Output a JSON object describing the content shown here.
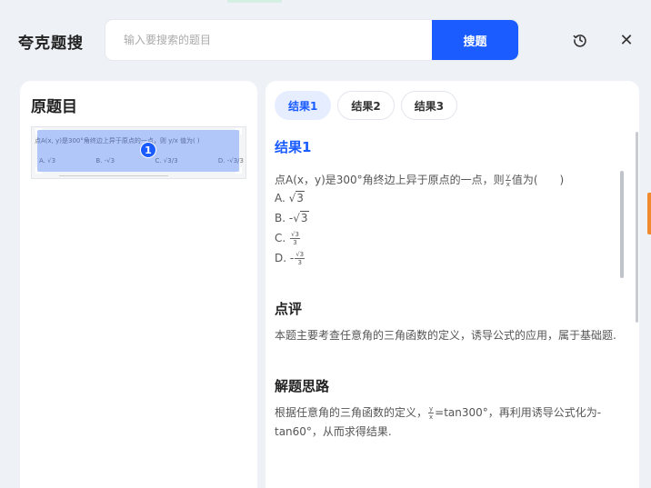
{
  "app": {
    "title": "夸克题搜"
  },
  "search": {
    "placeholder": "输入要搜索的题目",
    "value": "",
    "button_label": "搜题"
  },
  "toolbar": {
    "history_icon": "history-icon",
    "close_icon": "close-icon",
    "close_glyph": "✕"
  },
  "left_panel": {
    "title": "原题目",
    "thumbnail": {
      "question_text": "点A(x, y)是300°角终边上异于原点的一点，则 y/x 值为(   )",
      "options": [
        "A. √3",
        "B. -√3",
        "C. √3/3",
        "D. -√3/3"
      ],
      "badge": "1"
    }
  },
  "tabs": [
    {
      "label": "结果1",
      "active": true
    },
    {
      "label": "结果2",
      "active": false
    },
    {
      "label": "结果3",
      "active": false
    }
  ],
  "result": {
    "heading": "结果1",
    "question_pre": "点A(x，y)是300°角终边上异于原点的一点，则",
    "question_frac_num": "y",
    "question_frac_den": "x",
    "question_post": "值为(　　)",
    "options": {
      "a_label": "A. ",
      "a_value": "3",
      "b_label": "B. -",
      "b_value": "3",
      "c_label": "C. ",
      "c_num": "3",
      "c_den": "3",
      "d_label": "D. -",
      "d_num": "3",
      "d_den": "3"
    },
    "comment_title": "点评",
    "comment_text": "本题主要考查任意角的三角函数的定义，诱导公式的应用，属于基础题.",
    "approach_title": "解题思路",
    "approach_pre": "根据任意角的三角函数的定义，",
    "approach_frac_num": "y",
    "approach_frac_den": "x",
    "approach_post": "=tan300°，再利用诱导公式化为-tan60°，从而求得结果."
  },
  "colors": {
    "accent": "#1a5cff",
    "background": "#eef1f6",
    "edge_tab": "#f08a2c"
  }
}
